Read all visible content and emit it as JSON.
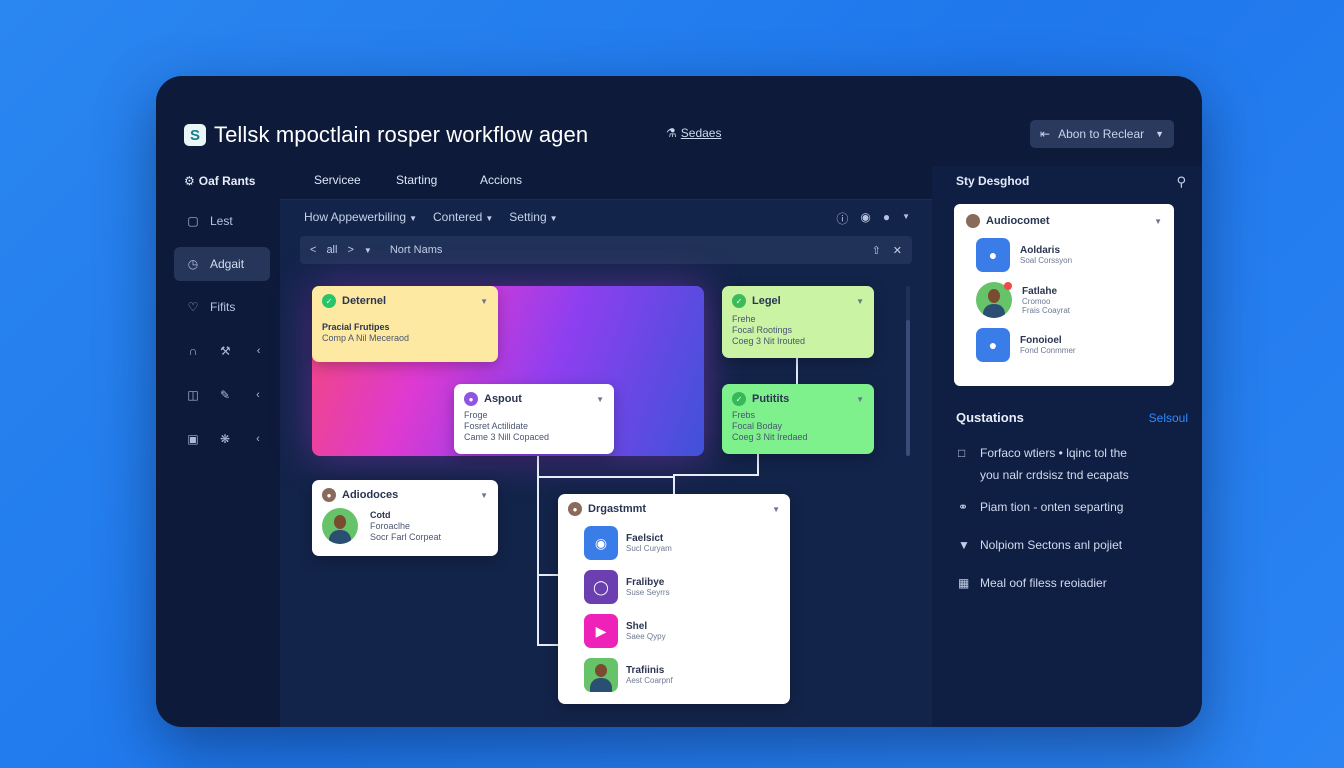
{
  "app": {
    "logo_letter": "S",
    "title": "Tellsk mpoctlain rosper workflow agen",
    "series_link": "Sedaes",
    "top_dropdown": "Abon to Reclear"
  },
  "sidebar": {
    "section_title": "Oaf Rants",
    "items": [
      {
        "label": "Lest",
        "icon": "clipboard-icon",
        "active": false
      },
      {
        "label": "Adgait",
        "icon": "clock-icon",
        "active": true
      },
      {
        "label": "Fifits",
        "icon": "heart-icon",
        "active": false
      }
    ],
    "icon_rows": [
      {
        "icon": "headphones-icon",
        "icon2": "wrench-icon"
      },
      {
        "icon": "tablet-icon",
        "icon2": "edit-icon"
      },
      {
        "icon": "image-icon",
        "icon2": "settings-icon"
      }
    ]
  },
  "main": {
    "tabs": [
      "Servicee",
      "Starting",
      "Accions"
    ],
    "filters": [
      "How Appewerbiling",
      "Contered",
      "Setting"
    ],
    "nav": {
      "back": "<",
      "current": "all",
      "forward": ">",
      "path": "Nort Nams"
    },
    "cards": {
      "card1": {
        "title": "Deternel",
        "line1": "Pracial Frutipes",
        "line2": "Comp A Nil Meceraod",
        "badge_color": "#29c46a"
      },
      "card2": {
        "title": "Legel",
        "line1": "Frehe",
        "line2": "Focal Rootings",
        "line3": "Coeg 3 Nit Irouted",
        "badge_color": "#3dbb5a"
      },
      "card3": {
        "title": "Aspout",
        "line1": "Froge",
        "line2": "Fosret Actilidate",
        "line3": "Came 3 Nill Copaced",
        "badge_color": "#8f55e0"
      },
      "card4": {
        "title": "Putitits",
        "line1": "Frebs",
        "line2": "Focal Boday",
        "line3": "Coeg 3 Nit Iredaed",
        "badge_color": "#36b85a"
      },
      "card5": {
        "title": "Adiodoces",
        "name": "Cotd",
        "line1": "Foroaclhe",
        "line2": "Socr Farl Corpeat"
      },
      "card6": {
        "title": "Drgastmmt",
        "rows": [
          {
            "title": "Faelsict",
            "sub": "Sucl Curyam",
            "color": "#3b7de8",
            "icon": "badge-icon"
          },
          {
            "title": "Fralibye",
            "sub": "Suse Seyrrs",
            "color": "#6b3fb0",
            "icon": "shield-icon"
          },
          {
            "title": "Shel",
            "sub": "Saee Qypy",
            "color": "#ee22b9",
            "icon": "play-icon"
          },
          {
            "title": "Trafiinis",
            "sub": "Aest Coarpnf",
            "color": "#66c36a",
            "icon": "person-icon"
          }
        ]
      }
    }
  },
  "right": {
    "header": "Sty Desghod",
    "card": {
      "title": "Audiocomet",
      "rows": [
        {
          "title": "Aoldaris",
          "sub": "Soal Corssyon",
          "type": "icon"
        },
        {
          "title": "Fatlahe",
          "line1": "Cromoo",
          "line2": "Frais Coayrat",
          "type": "avatar"
        },
        {
          "title": "Fonoioel",
          "sub": "Fond Conmmer",
          "type": "icon"
        }
      ]
    },
    "questions_title": "Qustations",
    "questions_link": "Selsoul",
    "questions": [
      {
        "icon": "chat-icon",
        "line1": "Forfaco wtiers • lqinc tol the",
        "line2": "you nalr crdsisz tnd ecapats"
      },
      {
        "icon": "link-icon",
        "line1": "Piam tion - onten separting"
      },
      {
        "icon": "funnel-icon",
        "line1": "Nolpiom Sectons anl pojiet"
      },
      {
        "icon": "grid-icon",
        "line1": "Meal oof filess reoiadier"
      }
    ]
  }
}
